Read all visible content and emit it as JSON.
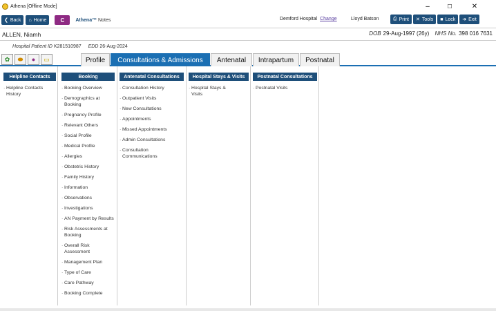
{
  "window": {
    "title": "Athena [Offline Mode]",
    "minimize": "–",
    "maximize": "☐",
    "close": "✕"
  },
  "toolbar": {
    "back": "Back",
    "home": "Home",
    "c_label": "C",
    "app_name": "Athena™",
    "app_sub": "Notes",
    "hospital": "Demford Hospital",
    "change": "Change",
    "user": "Lloyd Batson",
    "print": "Print",
    "tools": "Tools",
    "lock": "Lock",
    "exit": "Exit"
  },
  "patient": {
    "name": "ALLEN, Niamh",
    "dob_label": "DOB",
    "dob": "29-Aug-1997 (26y)",
    "nhs_label": "NHS No.",
    "nhs": "398 016 7631",
    "hpid_label": "Hospital Patient ID",
    "hpid": "K281510987",
    "edd_label": "EDD",
    "edd": "26-Aug-2024"
  },
  "tabs": [
    "Profile",
    "Consultations & Admissions",
    "Antenatal",
    "Intrapartum",
    "Postnatal"
  ],
  "columns": [
    {
      "title": "Helpline Contacts",
      "items": [
        "Helpline Contacts History"
      ]
    },
    {
      "title": "Booking",
      "items": [
        "Booking Overview",
        "Demographics at Booking",
        "Pregnancy Profile",
        "Relevant Others",
        "Social Profile",
        "Medical Profile",
        "Allergies",
        "Obstetric History",
        "Family History",
        "Information",
        "Observations",
        "Investigations",
        "AN Payment by Results",
        "Risk Assessments at Booking",
        "Overall Risk Assessment",
        "Management Plan",
        "Type of Care",
        "Care Pathway",
        "Booking Complete"
      ]
    },
    {
      "title": "Antenatal Consultations",
      "items": [
        "Consultation History",
        "Outpatient Visits",
        "New Consultations",
        "Appointments",
        "Missed Appointments",
        "Admin Consultations",
        "Consultation Communications"
      ]
    },
    {
      "title": "Hospital Stays & Visits",
      "items": [
        "Hospital Stays & Visits"
      ]
    },
    {
      "title": "Postnatal Consultations",
      "items": [
        "Postnatal Visits"
      ]
    }
  ]
}
